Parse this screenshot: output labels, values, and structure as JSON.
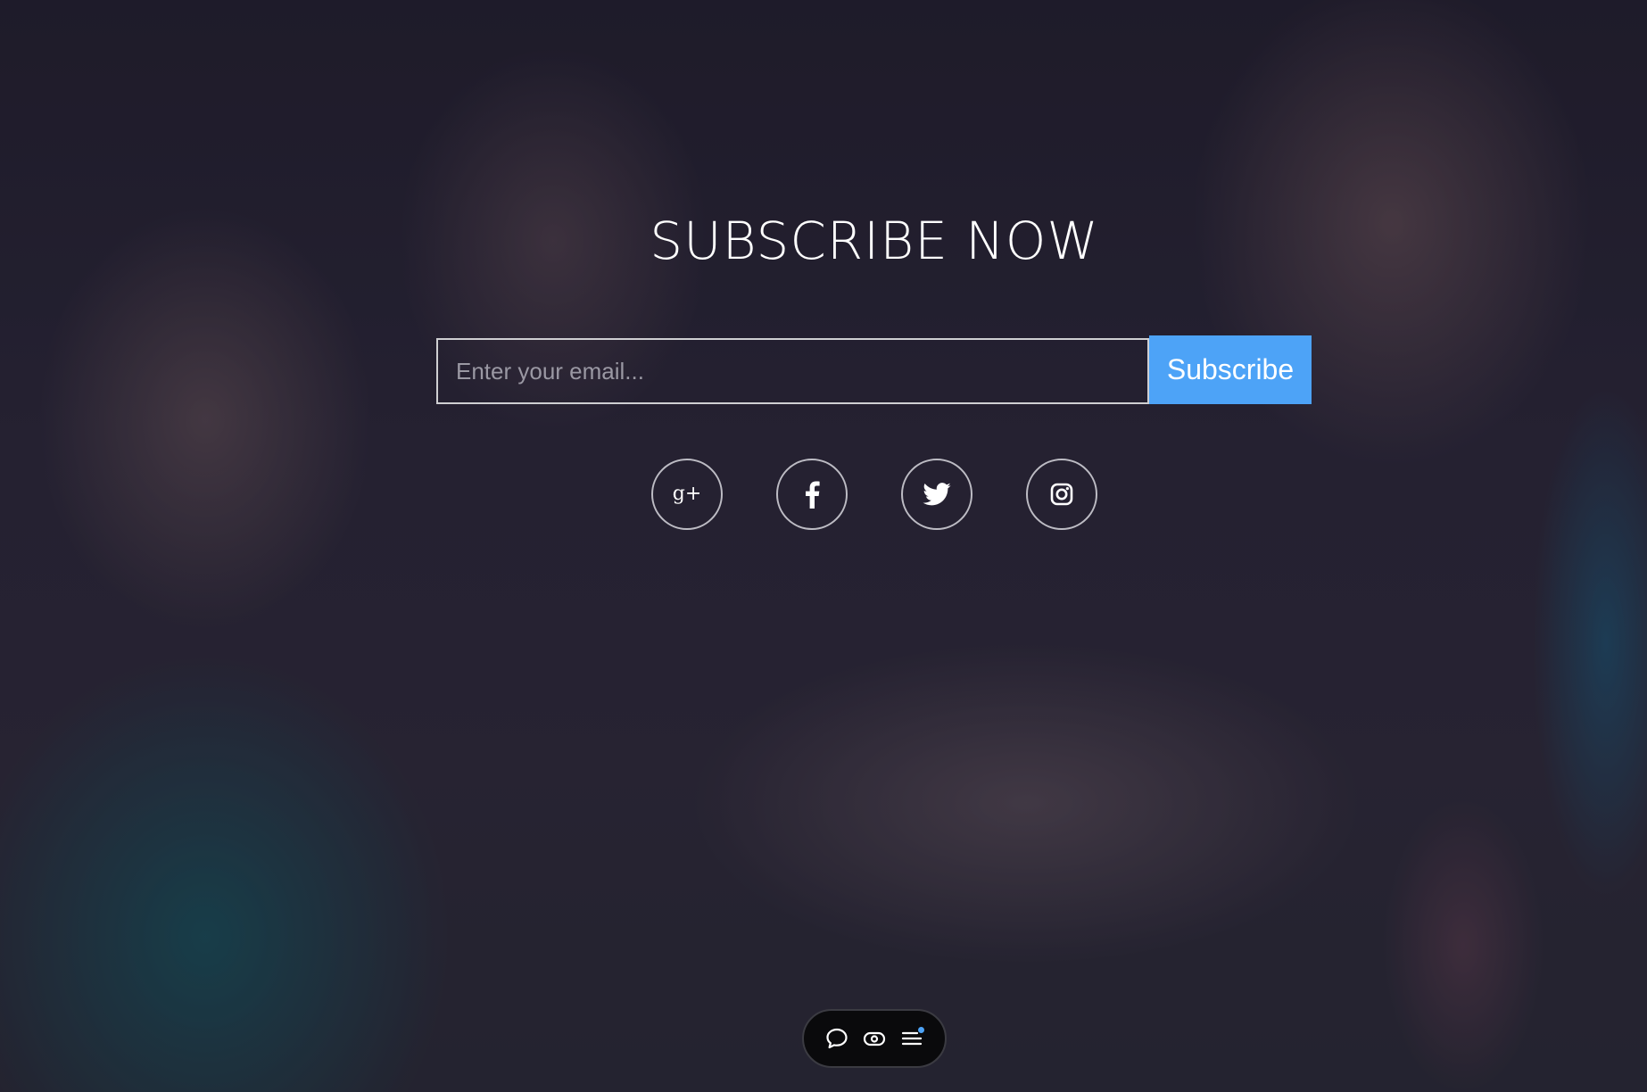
{
  "heading": {
    "title": "SUBSCRIBE NOW"
  },
  "form": {
    "email_placeholder": "Enter your email...",
    "email_value": "",
    "subscribe_label": "Subscribe"
  },
  "social": {
    "items": [
      {
        "icon": "google-plus-icon",
        "glyph": "g+"
      },
      {
        "icon": "facebook-icon"
      },
      {
        "icon": "twitter-icon"
      },
      {
        "icon": "instagram-icon"
      }
    ]
  },
  "toolbar": {
    "items": [
      {
        "icon": "chat-bubble-icon"
      },
      {
        "icon": "eye-icon"
      },
      {
        "icon": "menu-icon"
      }
    ],
    "notification_color": "#4da3f7"
  },
  "colors": {
    "accent": "#4da3f7",
    "text": "#ffffff",
    "background": "#2a2533"
  }
}
